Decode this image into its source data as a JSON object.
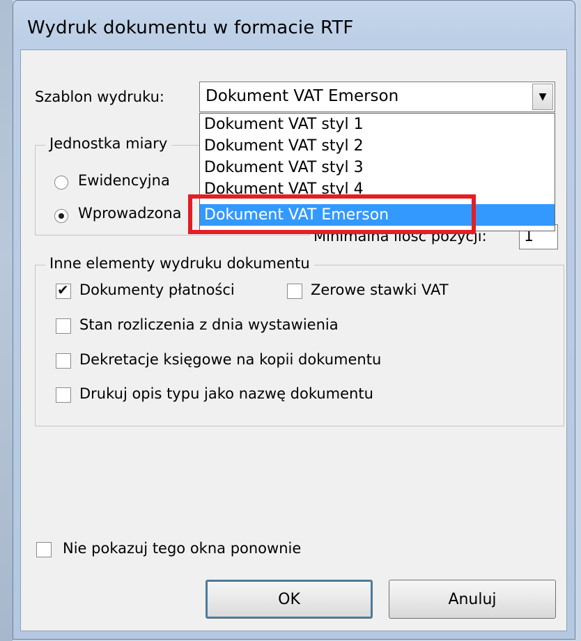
{
  "window": {
    "title": "Wydruk dokumentu w formacie RTF"
  },
  "template": {
    "label": "Szablon wydruku:",
    "selected": "Dokument VAT Emerson",
    "options": [
      "Dokument VAT styl 1",
      "Dokument VAT styl 2",
      "Dokument VAT styl 3",
      "Dokument VAT styl 4",
      "Dokument VAT Emerson"
    ],
    "highlighted_index": 4
  },
  "unit_group": {
    "legend": "Jednostka miary",
    "options": [
      {
        "label": "Ewidencyjna",
        "checked": false
      },
      {
        "label": "Wprowadzona",
        "checked": true
      }
    ],
    "min_position_label": "Minimalna ilość pozycji:",
    "min_position_value": "1"
  },
  "other_group": {
    "legend": "Inne elementy wydruku dokumentu",
    "payments": {
      "label": "Dokumenty płatności",
      "checked": true
    },
    "zero_vat": {
      "label": "Zerowe stawki VAT",
      "checked": false
    },
    "settlement": {
      "label": "Stan rozliczenia z dnia wystawienia",
      "checked": false
    },
    "decrees": {
      "label": "Dekretacje księgowe na kopii dokumentu",
      "checked": false
    },
    "type_desc": {
      "label": "Drukuj opis typu jako nazwę dokumentu",
      "checked": false
    }
  },
  "dont_show": {
    "label": "Nie pokazuj tego okna ponownie",
    "checked": false
  },
  "buttons": {
    "ok": "OK",
    "cancel": "Anuluj"
  },
  "colors": {
    "selection": "#3399ff",
    "highlight": "#e31e24"
  }
}
